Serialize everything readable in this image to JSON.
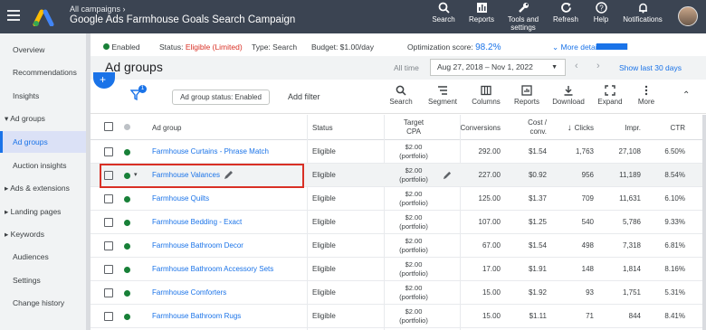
{
  "topbar": {
    "breadcrumb": "All campaigns",
    "title": "Google Ads Farmhouse Goals Search Campaign",
    "actions": [
      {
        "label": "Search",
        "icon": "search-icon"
      },
      {
        "label": "Reports",
        "icon": "reports-icon"
      },
      {
        "label": "Tools and settings",
        "label_line1": "Tools and",
        "label_line2": "settings",
        "icon": "wrench-icon"
      },
      {
        "label": "Refresh",
        "icon": "refresh-icon"
      },
      {
        "label": "Help",
        "icon": "help-icon"
      },
      {
        "label": "Notifications",
        "icon": "bell-icon"
      }
    ]
  },
  "sidebar": {
    "items": [
      {
        "label": "Overview"
      },
      {
        "label": "Recommendations"
      },
      {
        "label": "Insights"
      },
      {
        "label": "Ad groups"
      },
      {
        "label": "Ad groups"
      },
      {
        "label": "Auction insights"
      },
      {
        "label": "Ads & extensions"
      },
      {
        "label": "Landing pages"
      },
      {
        "label": "Keywords"
      },
      {
        "label": "Audiences"
      },
      {
        "label": "Settings"
      },
      {
        "label": "Change history"
      }
    ]
  },
  "status": {
    "enabled": "Enabled",
    "status_label": "Status:",
    "status_value": "Eligible (Limited)",
    "type": "Type: Search",
    "budget": "Budget: $1.00/day",
    "opt_label": "Optimization score:",
    "opt_value": "98.2%",
    "opt_fraction": 0.982,
    "more_details": "More details"
  },
  "header": {
    "title": "Ad groups",
    "all_time": "All time",
    "date_range": "Aug 27, 2018 – Nov 1, 2022",
    "show_last": "Show last 30 days"
  },
  "toolbar": {
    "filter_count": "1",
    "chip": "Ad group status: Enabled",
    "add_filter": "Add filter",
    "tools": [
      "Search",
      "Segment",
      "Columns",
      "Reports",
      "Download",
      "Expand",
      "More"
    ]
  },
  "table": {
    "headers": {
      "ad_group": "Ad group",
      "status": "Status",
      "target_cpa_1": "Target",
      "target_cpa_2": "CPA",
      "conversions": "Conversions",
      "cost_conv_1": "Cost /",
      "cost_conv_2": "conv.",
      "clicks": "Clicks",
      "impr": "Impr.",
      "ctr": "CTR"
    },
    "rows": [
      {
        "name": "Farmhouse Curtains - Phrase Match",
        "status": "Eligible",
        "target1": "$2.00",
        "target2": "(portfolio)",
        "conversions": "292.00",
        "cost_conv": "$1.54",
        "clicks": "1,763",
        "impr": "27,108",
        "ctr": "6.50%"
      },
      {
        "name": "Farmhouse Valances",
        "status": "Eligible",
        "target1": "$2.00",
        "target2": "(portfolio)",
        "conversions": "227.00",
        "cost_conv": "$0.92",
        "clicks": "956",
        "impr": "11,189",
        "ctr": "8.54%"
      },
      {
        "name": "Farmhouse Quilts",
        "status": "Eligible",
        "target1": "$2.00",
        "target2": "(portfolio)",
        "conversions": "125.00",
        "cost_conv": "$1.37",
        "clicks": "709",
        "impr": "11,631",
        "ctr": "6.10%"
      },
      {
        "name": "Farmhouse Bedding - Exact",
        "status": "Eligible",
        "target1": "$2.00",
        "target2": "(portfolio)",
        "conversions": "107.00",
        "cost_conv": "$1.25",
        "clicks": "540",
        "impr": "5,786",
        "ctr": "9.33%"
      },
      {
        "name": "Farmhouse Bathroom Decor",
        "status": "Eligible",
        "target1": "$2.00",
        "target2": "(portfolio)",
        "conversions": "67.00",
        "cost_conv": "$1.54",
        "clicks": "498",
        "impr": "7,318",
        "ctr": "6.81%"
      },
      {
        "name": "Farmhouse Bathroom Accessory Sets",
        "status": "Eligible",
        "target1": "$2.00",
        "target2": "(portfolio)",
        "conversions": "17.00",
        "cost_conv": "$1.91",
        "clicks": "148",
        "impr": "1,814",
        "ctr": "8.16%"
      },
      {
        "name": "Farmhouse Comforters",
        "status": "Eligible",
        "target1": "$2.00",
        "target2": "(portfolio)",
        "conversions": "15.00",
        "cost_conv": "$1.92",
        "clicks": "93",
        "impr": "1,751",
        "ctr": "5.31%"
      },
      {
        "name": "Farmhouse Bathroom Rugs",
        "status": "Eligible",
        "target1": "$2.00",
        "target2": "(portfolio)",
        "conversions": "15.00",
        "cost_conv": "$1.11",
        "clicks": "71",
        "impr": "844",
        "ctr": "8.41%"
      }
    ]
  },
  "colors": {
    "topbar": "#3b4452",
    "accent": "#1a73e8",
    "enabled_green": "#188038",
    "limited_red": "#d93025",
    "highlight_box": "#d93025"
  }
}
